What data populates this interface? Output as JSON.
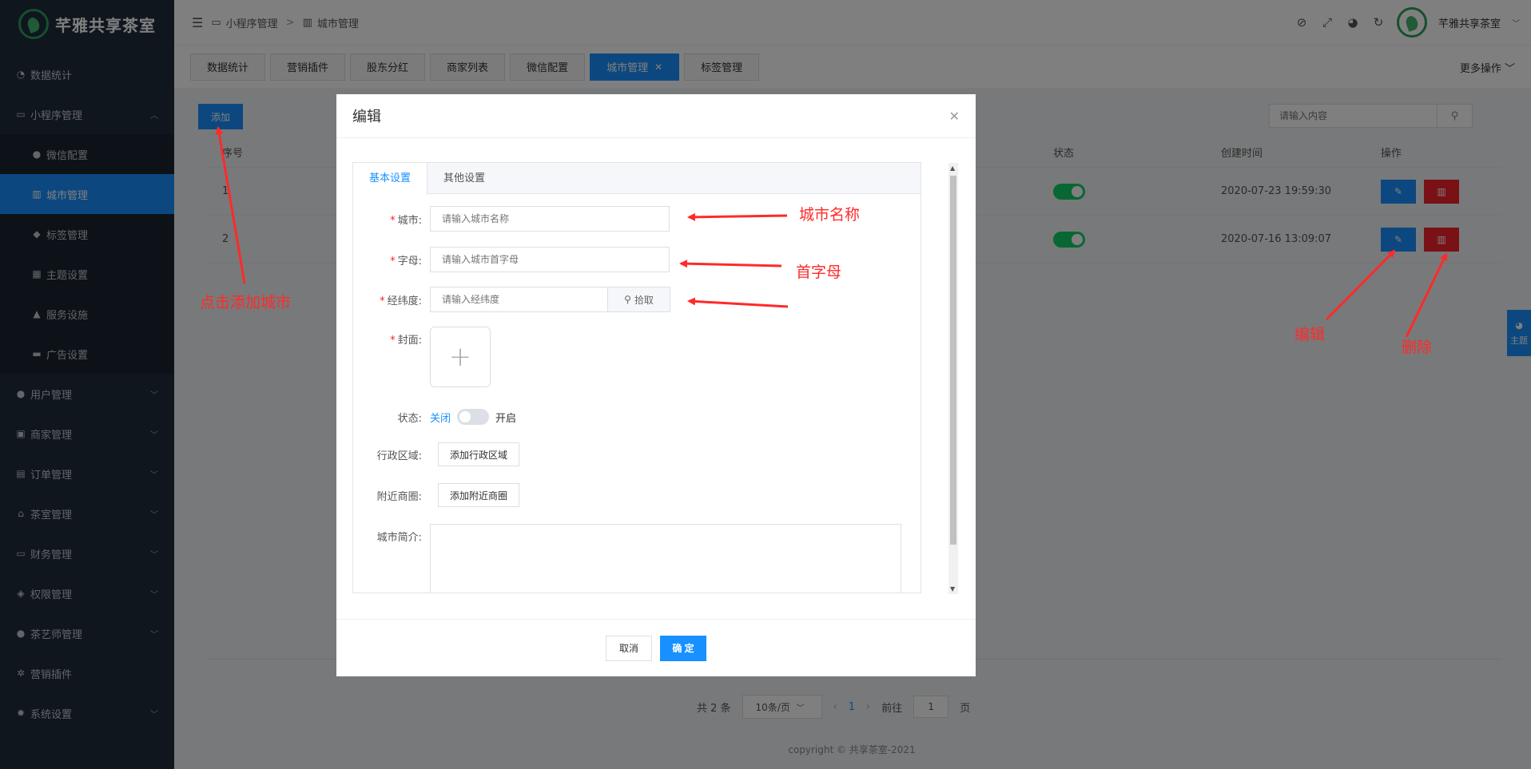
{
  "brand": {
    "name": "芊雅共享茶室"
  },
  "sidebar": {
    "items": [
      {
        "label": "数据统计",
        "icon": "dashboard-icon"
      },
      {
        "label": "小程序管理",
        "icon": "monitor-icon",
        "expanded": true
      },
      {
        "label": "微信配置",
        "icon": "wechat-icon",
        "sub": true
      },
      {
        "label": "城市管理",
        "icon": "building-icon",
        "sub": true,
        "active": true
      },
      {
        "label": "标签管理",
        "icon": "tag-icon",
        "sub": true
      },
      {
        "label": "主题设置",
        "icon": "grid-icon",
        "sub": true
      },
      {
        "label": "服务设施",
        "icon": "tree-icon",
        "sub": true
      },
      {
        "label": "广告设置",
        "icon": "card-icon",
        "sub": true
      },
      {
        "label": "用户管理",
        "icon": "users-icon"
      },
      {
        "label": "商家管理",
        "icon": "shop-icon"
      },
      {
        "label": "订单管理",
        "icon": "clipboard-icon"
      },
      {
        "label": "茶室管理",
        "icon": "home-icon"
      },
      {
        "label": "财务管理",
        "icon": "money-icon"
      },
      {
        "label": "权限管理",
        "icon": "database-icon"
      },
      {
        "label": "茶艺师管理",
        "icon": "user-lock-icon"
      },
      {
        "label": "营销插件",
        "icon": "cog-icon"
      },
      {
        "label": "系统设置",
        "icon": "settings-icon"
      }
    ]
  },
  "header": {
    "breadcrumb": [
      "小程序管理",
      "城市管理"
    ],
    "user_name": "芊雅共享茶室"
  },
  "tabs": [
    {
      "label": "数据统计"
    },
    {
      "label": "营销插件"
    },
    {
      "label": "股东分红"
    },
    {
      "label": "商家列表"
    },
    {
      "label": "微信配置"
    },
    {
      "label": "城市管理",
      "active": true
    },
    {
      "label": "标签管理"
    }
  ],
  "more_ops": "更多操作",
  "toolbar": {
    "add_label": "添加",
    "search_placeholder": "请输入内容"
  },
  "table": {
    "headers": {
      "id": "序号",
      "status": "状态",
      "created": "创建时间",
      "ops": "操作"
    },
    "rows": [
      {
        "id": "1",
        "created": "2020-07-23 19:59:30"
      },
      {
        "id": "2",
        "created": "2020-07-16 13:09:07"
      }
    ]
  },
  "pagination": {
    "total": "共 2 条",
    "page_size": "10条/页",
    "current": "1",
    "goto_label": "前往",
    "goto_value": "1",
    "page_suffix": "页"
  },
  "copyright": "copyright © 共享茶室-2021",
  "modal": {
    "title": "编辑",
    "tabs": [
      "基本设置",
      "其他设置"
    ],
    "fields": {
      "city_label": "城市:",
      "city_placeholder": "请输入城市名称",
      "letter_label": "字母:",
      "letter_placeholder": "请输入城市首字母",
      "latlng_label": "经纬度:",
      "latlng_placeholder": "请输入经纬度",
      "pick_label": "拾取",
      "cover_label": "封面:",
      "status_label": "状态:",
      "status_off": "关闭",
      "status_on": "开启",
      "district_label": "行政区域:",
      "district_btn": "添加行政区域",
      "nearby_label": "附近商圈:",
      "nearby_btn": "添加附近商圈",
      "intro_label": "城市简介:"
    },
    "cancel": "取消",
    "ok": "确 定"
  },
  "annotations": {
    "add_city": "点击添加城市",
    "city_name": "城市名称",
    "first_letter": "首字母",
    "edit": "编辑",
    "delete": "删除"
  },
  "theme_tab": "主题"
}
